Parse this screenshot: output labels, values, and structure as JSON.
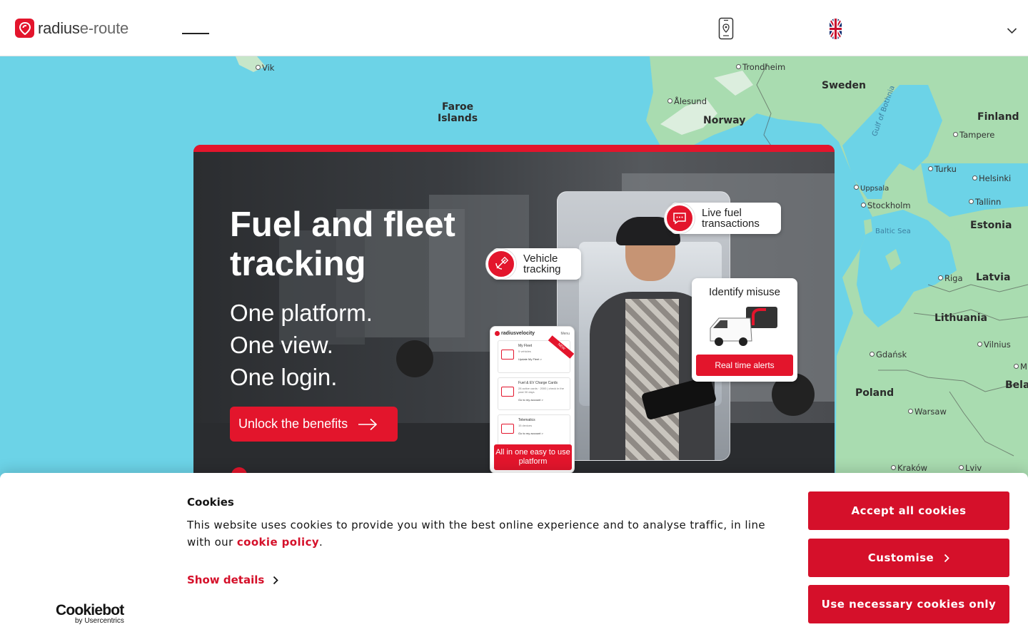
{
  "header": {
    "logo": {
      "part1": "radius",
      "part2": "e-route"
    },
    "icons": [
      "phone-location-icon",
      "uk-flag-icon",
      "chevron-down-icon"
    ]
  },
  "map": {
    "countries": [
      "Sweden",
      "Finland",
      "Norway",
      "Estonia",
      "Latvia",
      "Lithuania",
      "Poland",
      "Bela"
    ],
    "regions": [
      "Faroe",
      "Islands"
    ],
    "cities": [
      "Vik",
      "Trondheim",
      "Ålesund",
      "Tampere",
      "Turku",
      "Helsinki",
      "Uppsala",
      "Stockholm",
      "Tallinn",
      "Riga",
      "Vilnius",
      "Gdańsk",
      "Warsaw",
      "Kraków",
      "Lviv",
      "M"
    ],
    "water": [
      "Gulf of Bothnia",
      "Baltic Sea"
    ]
  },
  "hero": {
    "title": "Fuel and fleet tracking",
    "subtitle_lines": [
      "One platform.",
      "One view.",
      "One login."
    ],
    "cta_label": "Unlock the benefits",
    "bubble_live": "Live fuel transactions",
    "bubble_vehicle": "Vehicle tracking",
    "misuse_title": "Identify misuse",
    "misuse_button": "Real time alerts",
    "app": {
      "brand": "radiusvelocity",
      "menu": "Menu",
      "new_label": "NEW",
      "rows": [
        {
          "title": "My Fleet",
          "sub": "5 vehicles",
          "link": "Update My Fleet >"
        },
        {
          "title": "Fuel & EV Charge Cards",
          "sub": "28 active cards · 2000 | check in the past 30 days",
          "link": "Go to my account >"
        },
        {
          "title": "Telematics",
          "sub": "15 devices",
          "link": "Go to my account >"
        }
      ],
      "cta": "All in one easy to use platform"
    }
  },
  "cookie": {
    "title": "Cookies",
    "text": "This website uses cookies to provide you with the best online experience and to analyse traffic, in line with our",
    "link": "cookie policy",
    "period": ".",
    "show_details": "Show details",
    "accept_all": "Accept all cookies",
    "customise": "Customise",
    "necessary_only": "Use necessary cookies only",
    "provider_logo": "Cookiebot",
    "provider_by": "by Usercentrics"
  },
  "colors": {
    "brand_red": "#e3152c",
    "cookie_red": "#d5102a",
    "sea": "#6cd3e7",
    "land": "#a9dcb0"
  }
}
